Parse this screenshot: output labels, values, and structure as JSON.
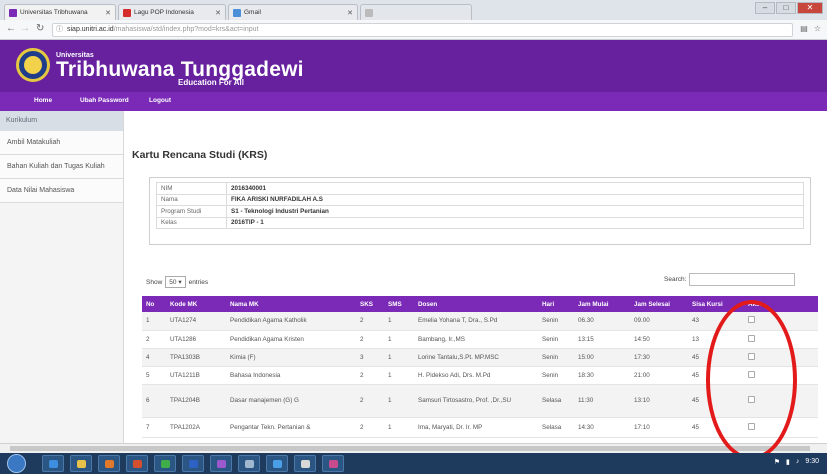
{
  "browser": {
    "tabs": [
      {
        "label": "Universitas Tribhuwana",
        "active": true
      },
      {
        "label": "Lagu POP Indonesia",
        "active": false
      },
      {
        "label": "Gmail",
        "active": false
      },
      {
        "label": "",
        "active": false
      }
    ],
    "url_host": "siap.unitri.ac.id",
    "url_path": "/mahasiswa/std/index.php?mod=krs&act=input"
  },
  "site": {
    "brand_small": "Universitas",
    "brand_name": "Tribhuwana Tunggadewi",
    "tagline": "Education For All"
  },
  "menu": {
    "items": [
      "Home",
      "Ubah Password",
      "Logout"
    ]
  },
  "sidebar": {
    "header": "Kurikulum",
    "items": [
      "Ambil Matakuliah",
      "Bahan Kuliah dan Tugas Kuliah",
      "Data Nilai Mahasiswa"
    ]
  },
  "main": {
    "title": "Kartu Rencana Studi (KRS)",
    "info": [
      {
        "label": "NIM",
        "value": "2016340001"
      },
      {
        "label": "Nama",
        "value": "FIKA ARISKI NURFADILAH A.S"
      },
      {
        "label": "Program Studi",
        "value": "S1 - Teknologi Industri Pertanian"
      },
      {
        "label": "Kelas",
        "value": "2016TIP - 1"
      }
    ],
    "show_label": "Show",
    "show_value": "50",
    "entries_label": "entries",
    "search_label": "Search:",
    "columns": [
      "No",
      "Kode MK",
      "Nama MK",
      "SKS",
      "SMS",
      "Dosen",
      "Hari",
      "Jam Mulai",
      "Jam Selesai",
      "Sisa Kursi",
      "Aksi"
    ],
    "rows": [
      {
        "no": "1",
        "kode": "UTA1274",
        "nama": "Pendidikan Agama Katholik",
        "sks": "2",
        "sms": "1",
        "dosen": "Emelia Yohana T, Dra., S.Pd",
        "hari": "Senin",
        "mulai": "06.30",
        "selesai": "09.00",
        "sisa": "43"
      },
      {
        "no": "2",
        "kode": "UTA1286",
        "nama": "Pendidikan Agama Kristen",
        "sks": "2",
        "sms": "1",
        "dosen": "Bambang, Ir.,MS",
        "hari": "Senin",
        "mulai": "13:15",
        "selesai": "14:50",
        "sisa": "13"
      },
      {
        "no": "4",
        "kode": "TPA1303B",
        "nama": "Kimia (F)",
        "sks": "3",
        "sms": "1",
        "dosen": "Lorine Tantalu,S.Pt. MP.MSC",
        "hari": "Senin",
        "mulai": "15:00",
        "selesai": "17:30",
        "sisa": "45"
      },
      {
        "no": "5",
        "kode": "UTA1211B",
        "nama": "Bahasa Indonesia",
        "sks": "2",
        "sms": "1",
        "dosen": "H. Pidekso Adi, Drs. M.Pd",
        "hari": "Senin",
        "mulai": "18:30",
        "selesai": "21:00",
        "sisa": "45"
      },
      {
        "no": "6",
        "kode": "TPA1204B",
        "nama": "Dasar manajemen (G)  G",
        "sks": "2",
        "sms": "1",
        "dosen": "Samsuri Tirtosastro, Prof. ,Dr.,SU",
        "hari": "Selasa",
        "mulai": "11:30",
        "selesai": "13:10",
        "sisa": "45"
      },
      {
        "no": "7",
        "kode": "TPA1202A",
        "nama": "Pengantar Tekn. Pertanian &",
        "sks": "2",
        "sms": "1",
        "dosen": "Ima, Maryati, Dr. Ir. MP",
        "hari": "Selasa",
        "mulai": "14:30",
        "selesai": "17:10",
        "sisa": "45"
      }
    ]
  },
  "taskbar": {
    "time": "9:30"
  },
  "colors": {
    "header_purple": "#67209e",
    "menu_purple": "#7a2ab7",
    "annotation_red": "#e31a1a"
  }
}
